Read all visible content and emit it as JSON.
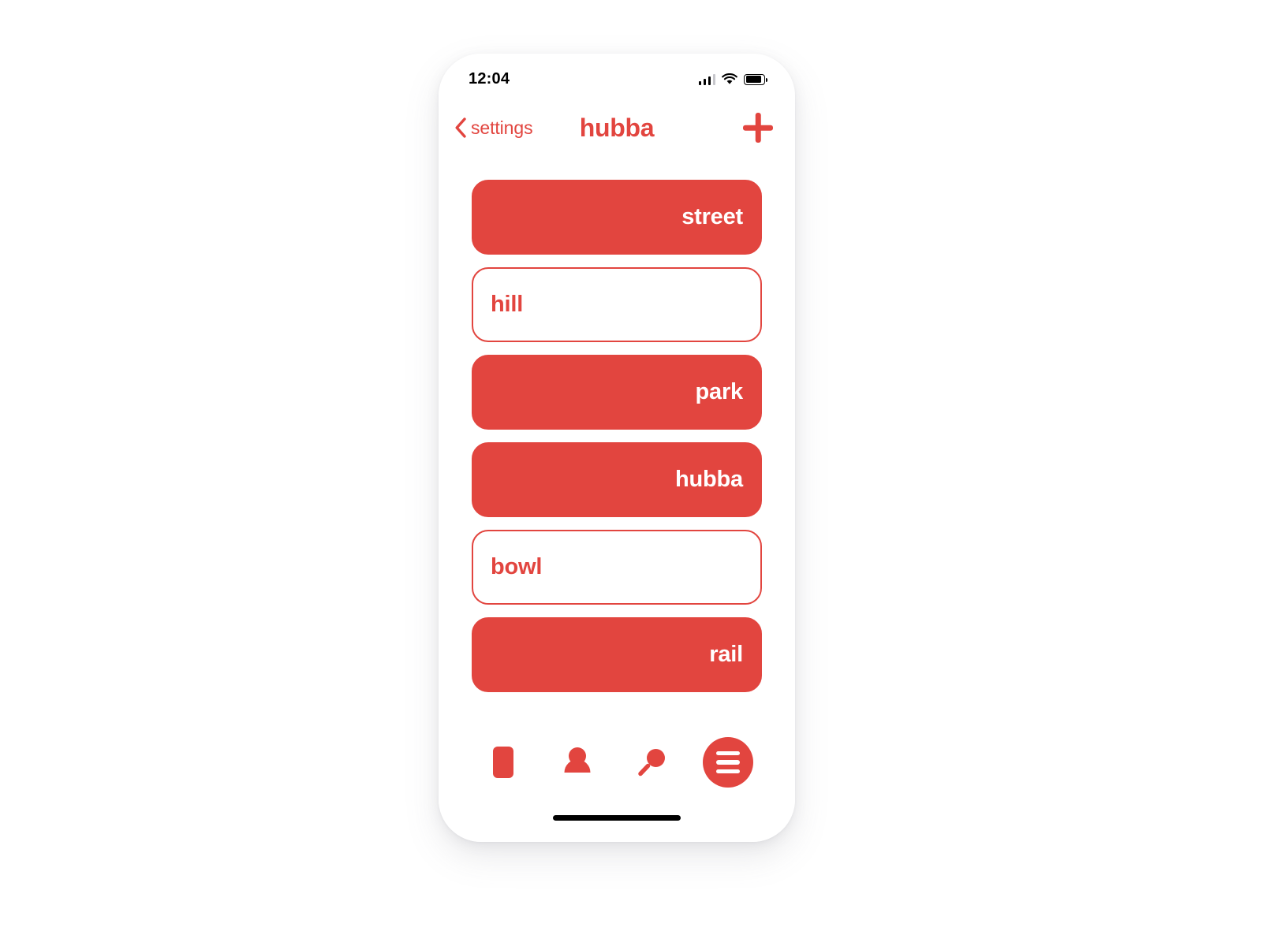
{
  "theme": {
    "accent": "#e2453f",
    "background": "#ffffff",
    "text_on_accent": "#ffffff",
    "status_text": "#000000"
  },
  "status_bar": {
    "time": "12:04",
    "signal_icon": "cellular-signal-icon",
    "signal_bars_filled": 3,
    "signal_bars_total": 4,
    "wifi_icon": "wifi-icon",
    "battery_icon": "battery-icon",
    "battery_level_percent": 88
  },
  "navbar": {
    "back_label": "settings",
    "back_icon": "chevron-left-icon",
    "title": "hubba",
    "add_icon": "plus-icon"
  },
  "list": {
    "items": [
      {
        "label": "street",
        "style": "filled",
        "align": "right"
      },
      {
        "label": "hill",
        "style": "outline",
        "align": "left"
      },
      {
        "label": "park",
        "style": "filled",
        "align": "right"
      },
      {
        "label": "hubba",
        "style": "filled",
        "align": "right"
      },
      {
        "label": "bowl",
        "style": "outline",
        "align": "left"
      },
      {
        "label": "rail",
        "style": "filled",
        "align": "right"
      }
    ]
  },
  "tabbar": {
    "items": [
      {
        "icon": "book-icon",
        "label": ""
      },
      {
        "icon": "person-icon",
        "label": ""
      },
      {
        "icon": "search-icon",
        "label": ""
      },
      {
        "icon": "hamburger-menu-icon",
        "label": ""
      }
    ]
  },
  "home_indicator": {
    "icon": "home-indicator-bar"
  }
}
